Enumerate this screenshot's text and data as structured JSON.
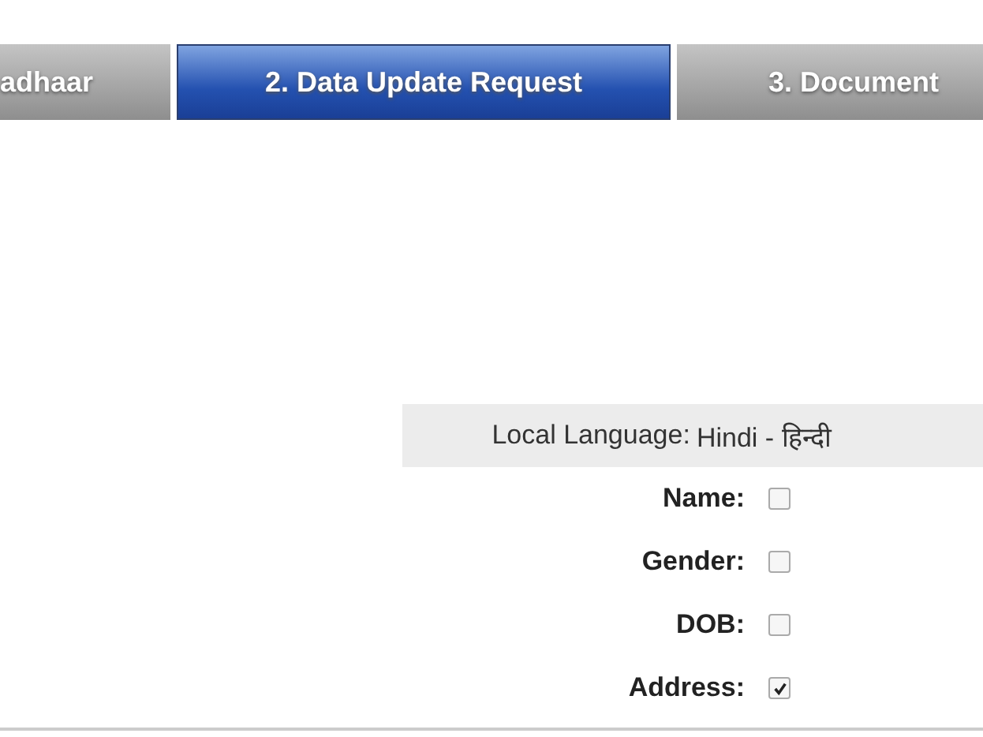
{
  "tabs": [
    {
      "label": "adhaar",
      "selected": false
    },
    {
      "label": "2. Data Update Request",
      "selected": true
    },
    {
      "label": "3. Document",
      "selected": false
    }
  ],
  "local_language": {
    "label": "Local Language:",
    "value": "Hindi - हिन्दी"
  },
  "fields": [
    {
      "label": "Name:",
      "checked": false
    },
    {
      "label": "Gender:",
      "checked": false
    },
    {
      "label": "DOB:",
      "checked": false
    },
    {
      "label": "Address:",
      "checked": true
    }
  ]
}
